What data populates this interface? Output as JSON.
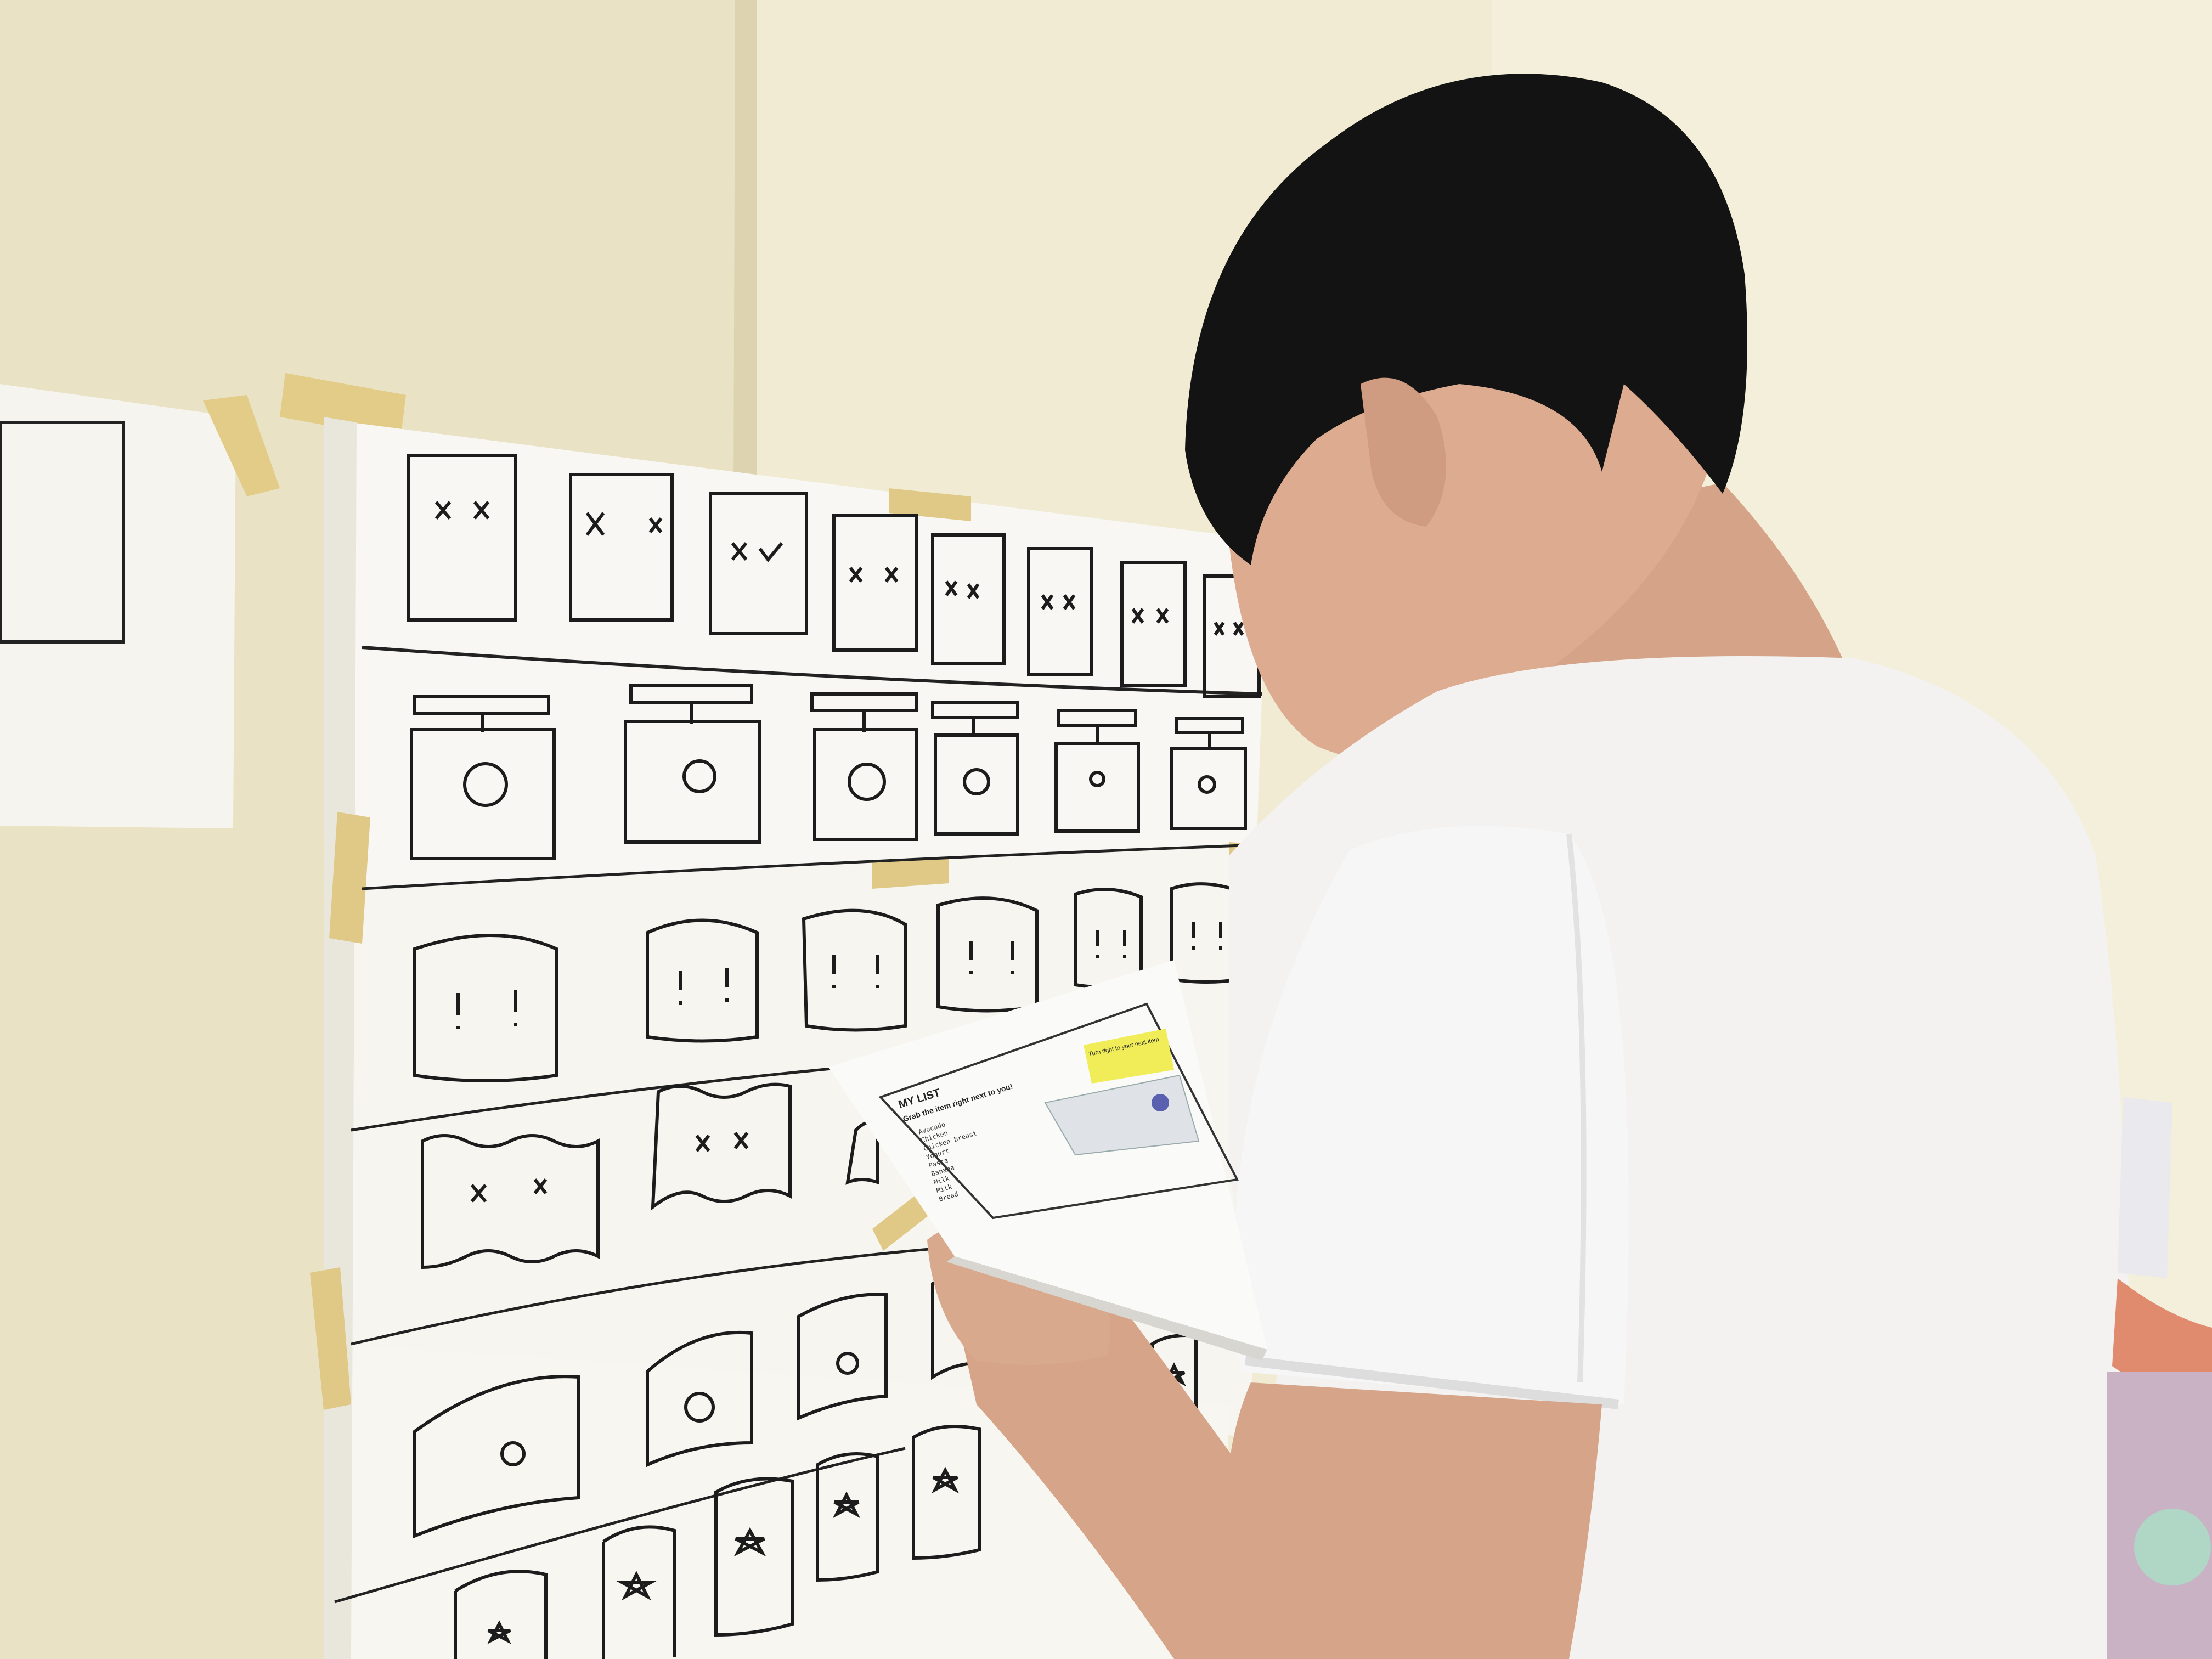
{
  "scene": {
    "description_colors": {
      "wall_left": "#ebe3c5",
      "wall_right": "#f1ecd3",
      "paper": "#f7f6f2",
      "tape": "#e3cf8e",
      "shirt": "#f4f3f3",
      "hair": "#141414",
      "skin": "#d9a98e",
      "sticky_note": "#f1ee5e"
    }
  },
  "handout": {
    "title": "MY LIST",
    "subtitle": "Grab the item right next to you!",
    "items": [
      "Avocado",
      "Chicken",
      "Chicken breast",
      "Yogurt",
      "Pasta",
      "Banana",
      "Milk",
      "Milk",
      "Bread"
    ],
    "note": "Turn right to your next item"
  },
  "sketches": {
    "row1_faces": 8,
    "row2_lamps": 6,
    "row3_exclaim": 6,
    "row4_wavy": 3,
    "row5_cylinders": 4,
    "row6_star_cylinders": 6
  }
}
